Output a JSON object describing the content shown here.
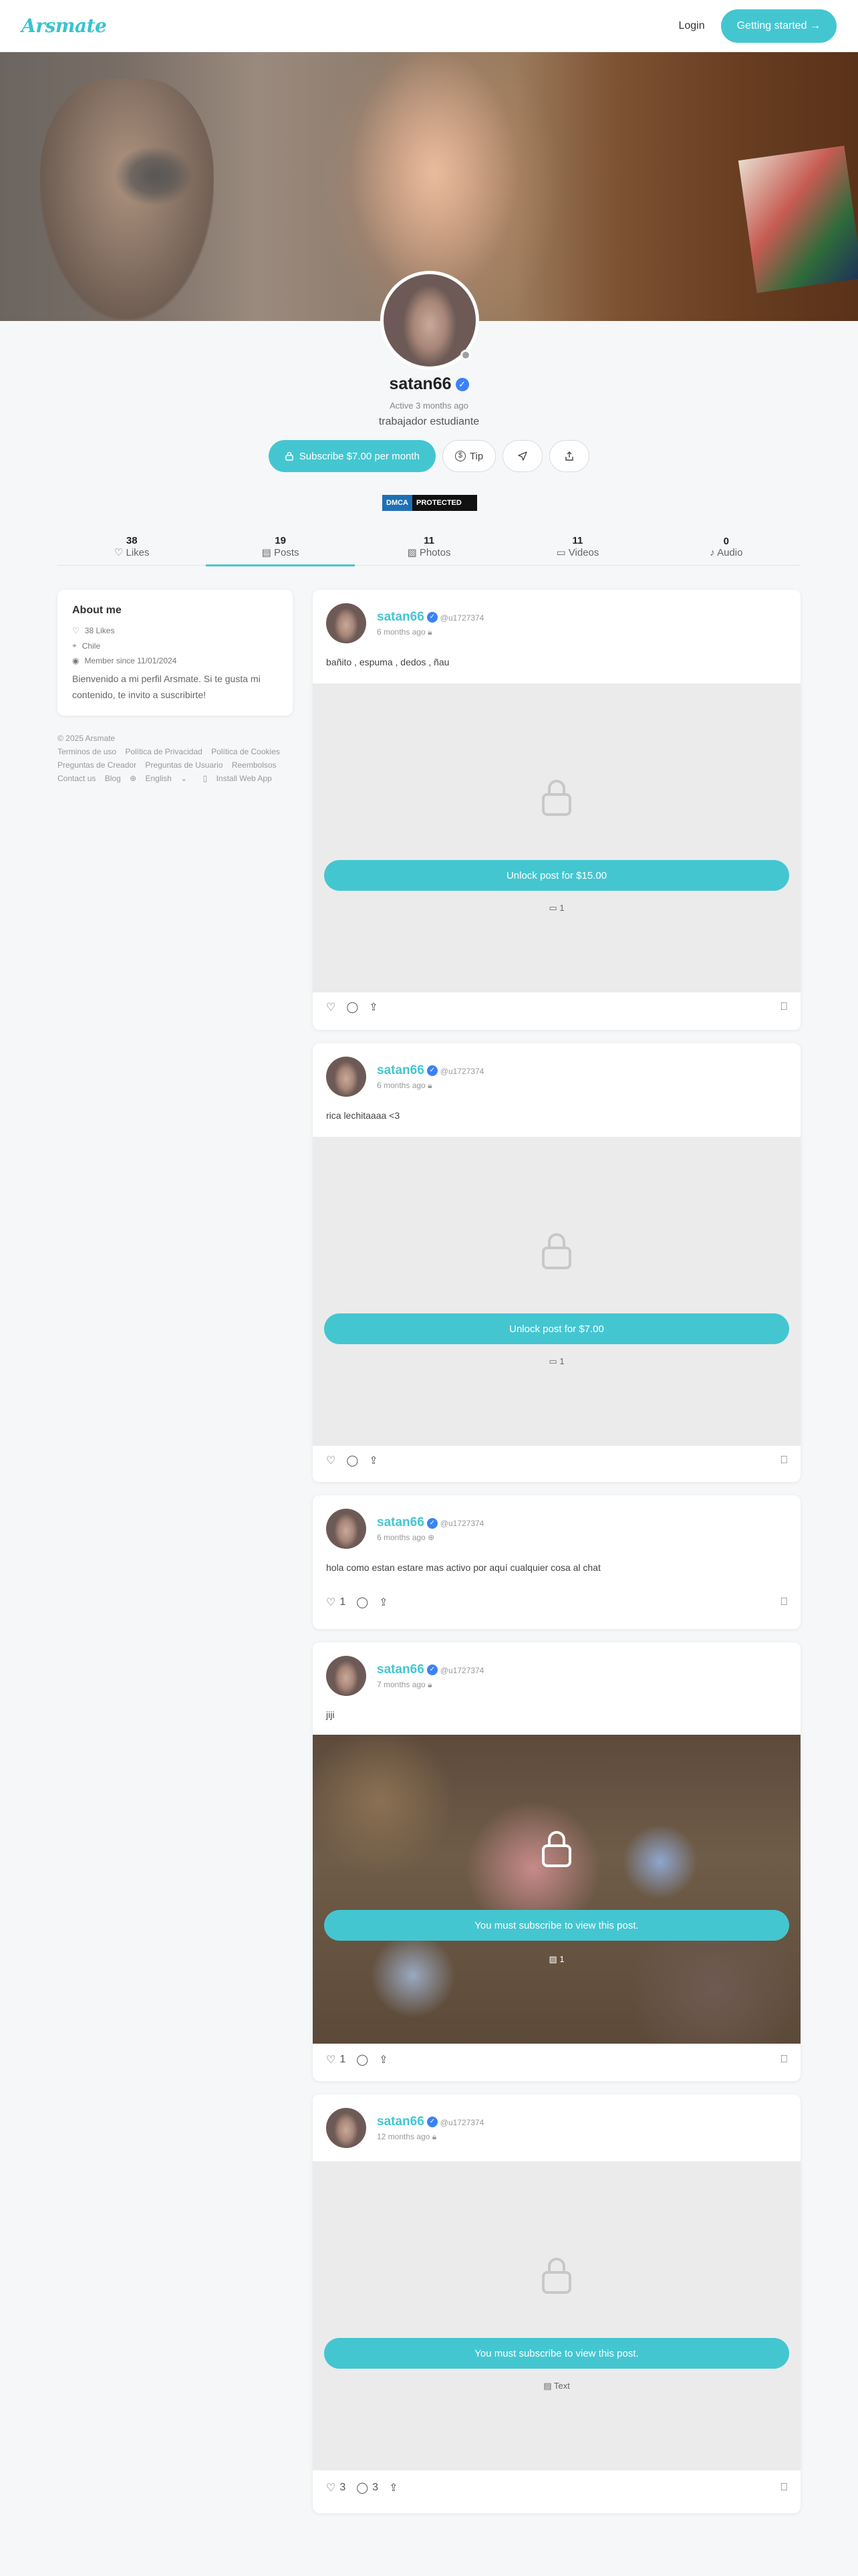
{
  "header": {
    "logo": "Arsmate",
    "login": "Login",
    "cta": "Getting started →"
  },
  "profile": {
    "name": "satan66",
    "active": "Active 3 months ago",
    "bio": "trabajador estudiante",
    "subscribe": "Subscribe $7.00 per month",
    "tip": "Tip",
    "dmca_a": "DMCA",
    "dmca_b": "PROTECTED"
  },
  "tabs": [
    {
      "count": "38",
      "label": "Likes"
    },
    {
      "count": "19",
      "label": "Posts"
    },
    {
      "count": "11",
      "label": "Photos"
    },
    {
      "count": "11",
      "label": "Videos"
    },
    {
      "count": "0",
      "label": "Audio"
    }
  ],
  "about": {
    "title": "About me",
    "likes": "38 Likes",
    "location": "Chile",
    "member": "Member since 11/01/2024",
    "desc": "Bienvenido a mi perfil Arsmate. Si te gusta mi contenido, te invito a suscribirte!"
  },
  "footer": {
    "copyright": "© 2025 Arsmate",
    "links": [
      "Terminos de uso",
      "Política de Privacidad",
      "Política de Cookies",
      "Preguntas de Creador",
      "Preguntas de Usuario",
      "Reembolsos",
      "Contact us",
      "Blog"
    ],
    "language": "English",
    "install": "Install Web App"
  },
  "posts": [
    {
      "user": "satan66",
      "handle": "@u1727374",
      "time": "6 months ago",
      "text": "bañito , espuma , dedos , ñau",
      "cta": "Unlock post for $15.00",
      "count": "1",
      "likes": "",
      "comments": ""
    },
    {
      "user": "satan66",
      "handle": "@u1727374",
      "time": "6 months ago",
      "text": "rica lechitaaaa <3",
      "cta": "Unlock post for $7.00",
      "count": "1",
      "likes": "",
      "comments": ""
    },
    {
      "user": "satan66",
      "handle": "@u1727374",
      "time": "6 months ago",
      "text": "hola como estan estare mas activo por aquí cualquier cosa al chat",
      "likes": "1",
      "comments": ""
    },
    {
      "user": "satan66",
      "handle": "@u1727374",
      "time": "7 months ago",
      "text": "jiji",
      "cta": "You must subscribe to view this post.",
      "count": "1",
      "likes": "1",
      "comments": ""
    },
    {
      "user": "satan66",
      "handle": "@u1727374",
      "time": "12 months ago",
      "text": "",
      "cta": "You must subscribe to view this post.",
      "count": "Text",
      "likes": "3",
      "comments": "3"
    }
  ]
}
